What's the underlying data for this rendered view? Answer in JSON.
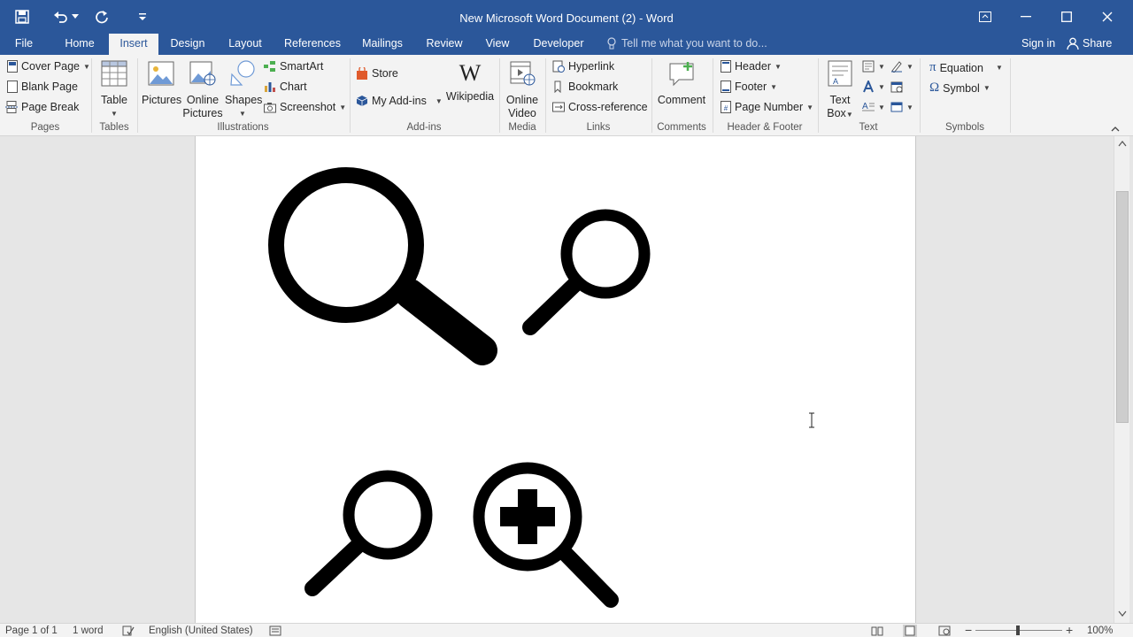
{
  "window": {
    "title": "New Microsoft Word Document (2) - Word"
  },
  "tabs": [
    "File",
    "Home",
    "Insert",
    "Design",
    "Layout",
    "References",
    "Mailings",
    "Review",
    "View",
    "Developer"
  ],
  "active_tab": "Insert",
  "tell_me": "Tell me what you want to do...",
  "account": {
    "sign_in": "Sign in",
    "share": "Share"
  },
  "ribbon": {
    "pages": {
      "label": "Pages",
      "cover_page": "Cover Page",
      "blank_page": "Blank Page",
      "page_break": "Page Break"
    },
    "tables": {
      "label": "Tables",
      "table": "Table"
    },
    "illustrations": {
      "label": "Illustrations",
      "pictures": "Pictures",
      "online_pictures_1": "Online",
      "online_pictures_2": "Pictures",
      "shapes": "Shapes",
      "smartart": "SmartArt",
      "chart": "Chart",
      "screenshot": "Screenshot"
    },
    "addins": {
      "label": "Add-ins",
      "store": "Store",
      "my_addins": "My Add-ins",
      "wikipedia": "Wikipedia"
    },
    "media": {
      "label": "Media",
      "online_video_1": "Online",
      "online_video_2": "Video"
    },
    "links": {
      "label": "Links",
      "hyperlink": "Hyperlink",
      "bookmark": "Bookmark",
      "cross_reference": "Cross-reference"
    },
    "comments": {
      "label": "Comments",
      "comment": "Comment"
    },
    "header_footer": {
      "label": "Header & Footer",
      "header": "Header",
      "footer": "Footer",
      "page_number": "Page Number"
    },
    "text": {
      "label": "Text",
      "text_box_1": "Text",
      "text_box_2": "Box"
    },
    "symbols": {
      "label": "Symbols",
      "equation": "Equation",
      "symbol": "Symbol"
    }
  },
  "status": {
    "page": "Page 1 of 1",
    "words": "1 word",
    "language": "English (United States)",
    "zoom": "100%"
  },
  "colors": {
    "accent": "#2b579a",
    "ribbon_bg": "#f3f3f3",
    "doc_bg": "#e6e6e6"
  }
}
